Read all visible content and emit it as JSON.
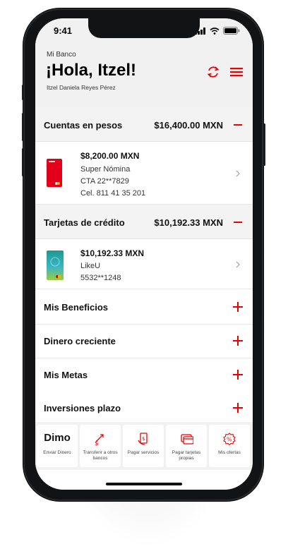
{
  "status_bar": {
    "time": "9:41"
  },
  "header": {
    "bank": "Mi Banco",
    "greeting": "¡Hola, Itzel!",
    "user_full_name": "Itzel Daniela Reyes Pérez"
  },
  "sections": {
    "pesos": {
      "title": "Cuentas en pesos",
      "total": "$16,400.00 MXN"
    },
    "credit": {
      "title": "Tarjetas de crédito",
      "total": "$10,192.33 MXN"
    }
  },
  "accounts": {
    "nomina": {
      "amount": "$8,200.00 MXN",
      "name": "Super Nómina",
      "cta": "CTA 22**7829",
      "cel": "Cel. 811 41 35 201"
    },
    "likeu": {
      "amount": "$10,192.33 MXN",
      "name": "LikeU",
      "number": "5532**1248"
    }
  },
  "rows": [
    {
      "label": "Mis Beneficios"
    },
    {
      "label": "Dinero creciente"
    },
    {
      "label": "Mis Metas"
    },
    {
      "label": "Inversiones plazo"
    }
  ],
  "quick_actions": [
    {
      "logo": "Dimo",
      "label": "Enviar Dinero",
      "icon": "dimo-logo"
    },
    {
      "label": "Transferir a otros bancos",
      "icon": "transfer-icon"
    },
    {
      "label": "Pagar servicios",
      "icon": "pay-services-icon"
    },
    {
      "label": "Pagar tarjetas propias",
      "icon": "pay-cards-icon"
    },
    {
      "label": "Mis ofertas",
      "icon": "offers-icon"
    }
  ],
  "colors": {
    "accent": "#ec0000",
    "header_bg": "#f1f1f1"
  }
}
